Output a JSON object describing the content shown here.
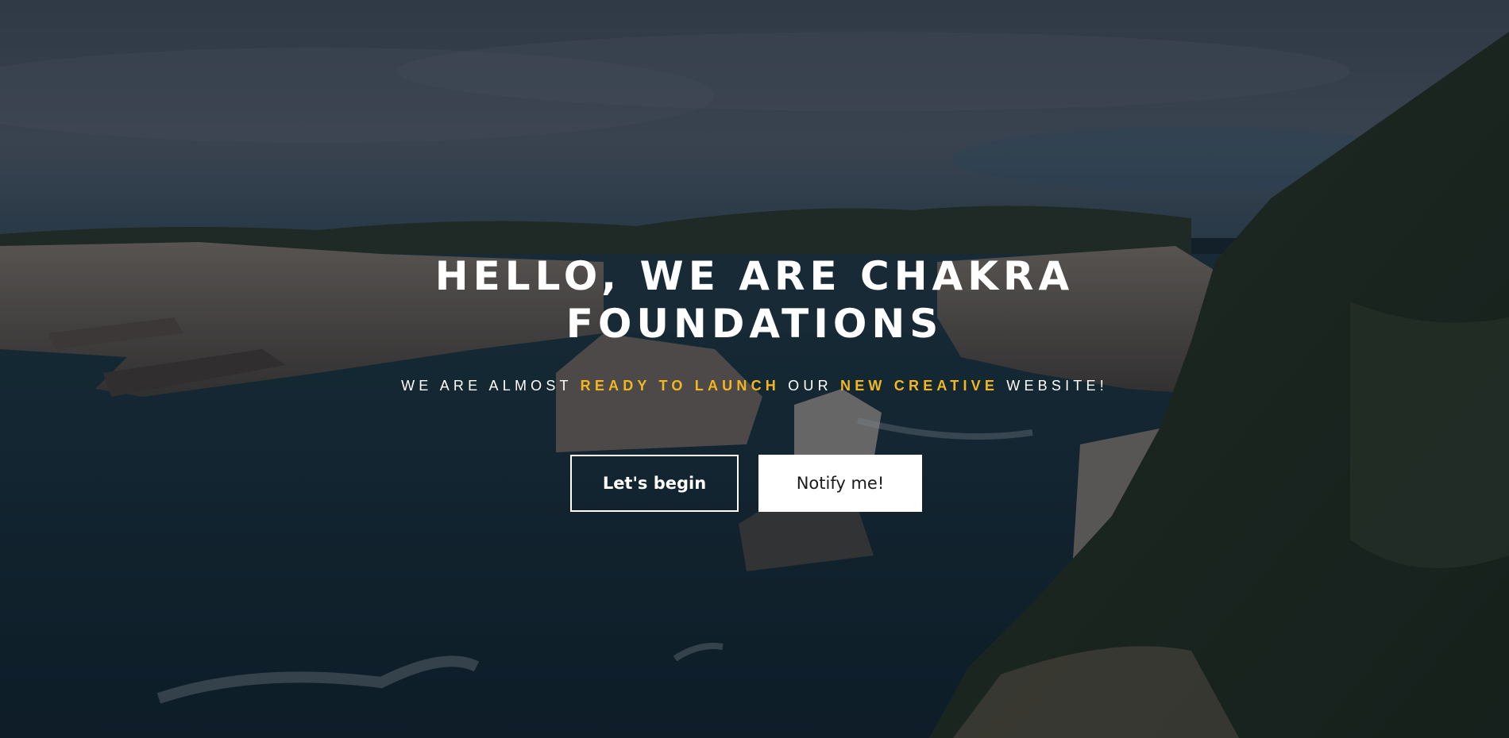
{
  "hero": {
    "title_line1": "HELLO, WE ARE CHAKRA",
    "title_line2": "FOUNDATIONS",
    "subtitle_part1": "WE ARE ALMOST ",
    "subtitle_highlight1": "READY TO LAUNCH",
    "subtitle_part2": " OUR ",
    "subtitle_highlight2": "NEW CREATIVE",
    "subtitle_part3": " WEBSITE!",
    "accent_color": "#f2b71f"
  },
  "buttons": {
    "begin_label": "Let's begin",
    "notify_label": "Notify me!"
  }
}
